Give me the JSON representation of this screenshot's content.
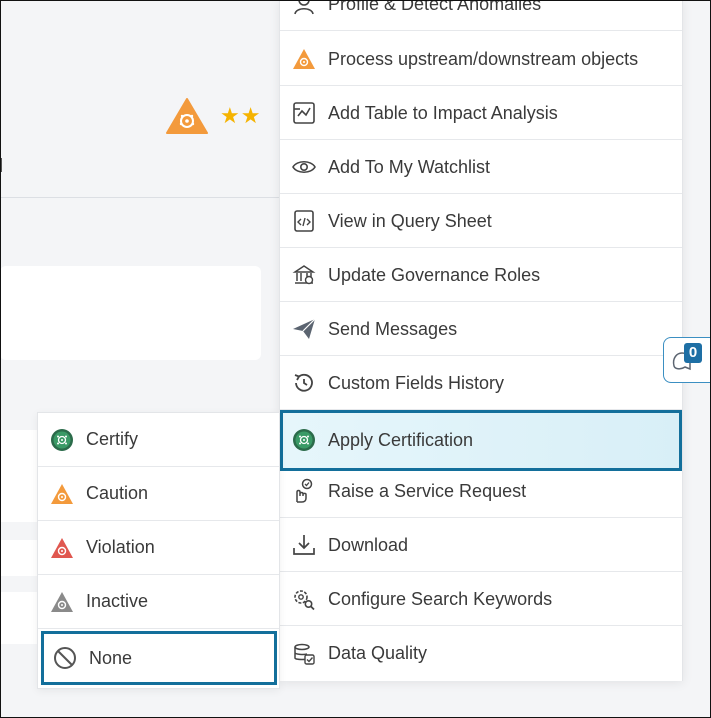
{
  "colors": {
    "accent_outline": "#136f9b",
    "certify": "#2e7d5b",
    "caution": "#f39a3c",
    "violation": "#e0574f",
    "inactive": "#8a8a8a",
    "star": "#f5b301"
  },
  "header": {
    "certification_icon": "caution-certification-icon",
    "rating_stars": "★★"
  },
  "actions_menu": {
    "items": [
      {
        "label": "Profile & Detect Anomalies",
        "icon": "user-icon"
      },
      {
        "label": "Process upstream/downstream objects",
        "icon": "caution-icon"
      },
      {
        "label": "Add Table to Impact Analysis",
        "icon": "impact-analysis-icon"
      },
      {
        "label": "Add To My Watchlist",
        "icon": "eye-icon"
      },
      {
        "label": "View in Query Sheet",
        "icon": "code-file-icon"
      },
      {
        "label": "Update Governance Roles",
        "icon": "governance-icon"
      },
      {
        "label": "Send Messages",
        "icon": "paper-plane-icon"
      },
      {
        "label": "Custom Fields History",
        "icon": "history-icon"
      },
      {
        "label": "Apply Certification",
        "icon": "certify-icon"
      },
      {
        "label": "Raise a Service Request",
        "icon": "service-request-icon"
      },
      {
        "label": "Download",
        "icon": "download-icon"
      },
      {
        "label": "Configure Search Keywords",
        "icon": "search-settings-icon"
      },
      {
        "label": "Data Quality",
        "icon": "data-quality-icon"
      }
    ],
    "active_item": "Apply Certification"
  },
  "certification_submenu": {
    "items": [
      {
        "label": "Certify",
        "icon": "certify-icon"
      },
      {
        "label": "Caution",
        "icon": "caution-icon"
      },
      {
        "label": "Violation",
        "icon": "violation-icon"
      },
      {
        "label": "Inactive",
        "icon": "inactive-icon"
      },
      {
        "label": "None",
        "icon": "none-icon"
      }
    ],
    "active_item": "None"
  },
  "chat_widget": {
    "count": "0",
    "icon": "chat-bell-icon"
  }
}
